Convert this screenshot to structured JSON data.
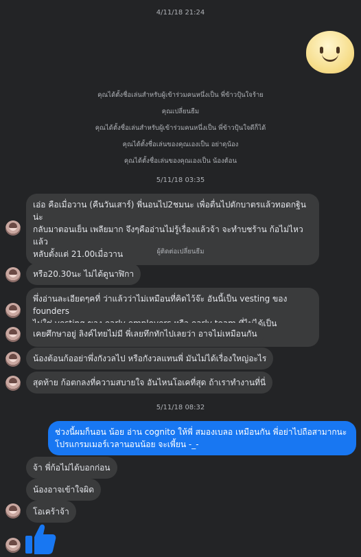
{
  "timestamps": [
    "4/11/18 21:24",
    "5/11/18 03:35",
    "5/11/18 08:32"
  ],
  "system_messages": [
    "คุณได้ตั้งชื่อเล่นสำหรับผู้เข้าร่วมคนหนึ่งเป็น พี่ข้าวปุ้นใจร้าย",
    "คุณเปลี่ยนธีม",
    "คุณได้ตั้งชื่อเล่นสำหรับผู้เข้าร่วมคนหนึ่งเป็น พี่ข้าวปุ้นใจดีก็ได้",
    "คุณได้ตั้งชื่อเล่นของคุณเองเป็น อย่าดุน้อง",
    "คุณได้ตั้งชื่อเล่นของคุณเองเป็น น้องต้อน"
  ],
  "system_message_2": "ผู้ติดต่อเปลี่ยนธีม",
  "messages": {
    "m1": "เอ่อ คือเมื่อวาน (คืนวันเสาร์) พี่นอนไป2ชมนะ เพื่อตื่นไปตักบาตรแล้วทอดกฐิน น่ะ\nกลับมาตอนเย็น เพลียมาก จึงๆคืออ่านไม่รู้เรื่องแล้วจ้า จะทำบชร้าน ก้อไม่ไหวแล้ว\nหลับตั้งแต่ 21.00เมื่อวาน",
    "m2": "หรือ20.30นะ ไม่ได้ดูนาฬิกา",
    "m3": "พึ่งอ่านละเอียดๆคที่ ว่าแล้วว่าไม่เหมือนที่คิดไว้จ๊ะ อันนี้เป็น vesting ของ founders\nไม่ใช่ vesting ของ early employers หรือ early team ที่ไม่ได้เป็น founders",
    "m4": "เคยศึกษาอยู่ ลิงค์ไทยไม่มี พี่เลยทึกทักไปเลยว่า อาจไม่เหมือนกัน",
    "m5": "น้องต้อนก้ออย่าพึ่งกังวลไป หรือกังวลแทนพี่ มันไม่ได้เรื่องใหญ่อะไร",
    "m6": "สุดท้าย ก้อตกลงที่ความสบายใจ อันไหนโอเคที่สุด ถ้าเราทำงานที่นี่",
    "m7": "ช่วงนี้ผมก็นอน น้อย อ่าน cognito ให้พี่ สมองเบลอ เหมือนกัน พี่อย่าไปถือสามากนะ\nโปรแกรมเมอร์เวลานอนน้อย จะเพี้ยน -_-",
    "m8": "จ้า พี่ก้อไม่ได้บอกก่อน",
    "m9": "น้องอาจเข้าใจผิด",
    "m10": "โอเคร้าจ้า"
  },
  "icons": {
    "sticker": "smiley-sticker-icon",
    "like": "thumbs-up-icon",
    "avatar": "contact-avatar"
  },
  "colors": {
    "background": "#232426",
    "incoming": "#3a3b3c",
    "outgoing": "#1877f2"
  }
}
